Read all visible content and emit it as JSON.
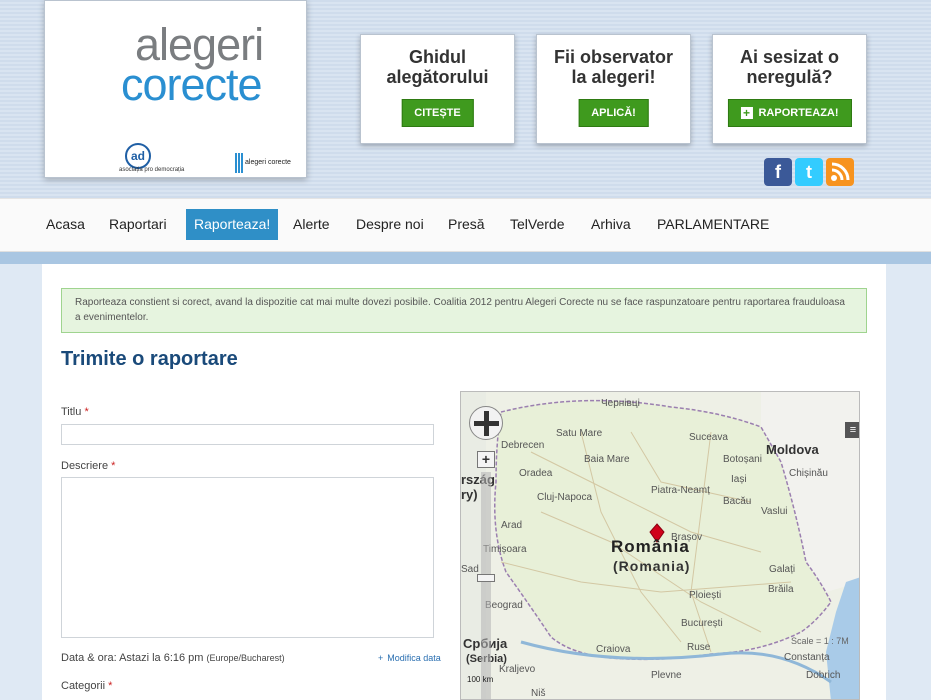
{
  "header": {
    "logo_line1": "alegeri",
    "logo_line2": "corecte",
    "partner_logo_mark": "ad",
    "partner_caption": "asociația pro democrația",
    "small_logo_text": "alegeri corecte"
  },
  "promos": [
    {
      "title_line1": "Ghidul",
      "title_line2": "alegătorului",
      "button": "CITEȘTE"
    },
    {
      "title_line1": "Fii observator",
      "title_line2": "la alegeri!",
      "button": "APLICĂ!"
    },
    {
      "title_line1": "Ai sesizat o",
      "title_line2": "neregulă?",
      "button": "RAPORTEAZA!"
    }
  ],
  "social": {
    "facebook": "f",
    "twitter": "t",
    "rss": "rss"
  },
  "nav": [
    "Acasa",
    "Raportari",
    "Raporteaza!",
    "Alerte",
    "Despre noi",
    "Presă",
    "TelVerde",
    "Arhiva",
    "PARLAMENTARE"
  ],
  "notice": "Raporteaza constient si corect, avand la dispozitie cat mai multe dovezi posibile. Coalitia 2012 pentru Alegeri Corecte nu se face raspunzatoare pentru raportarea frauduloasa a evenimentelor.",
  "form": {
    "title": "Trimite o raportare",
    "titlu_label": "Titlu",
    "titlu_value": "",
    "descriere_label": "Descriere",
    "descriere_value": "",
    "required_mark": "*",
    "date_prefix": "Data & ora: Astazi la 6:16 pm",
    "date_tz": "(Europe/Bucharest)",
    "modify_link": "Modifica data",
    "categorii_label": "Categorii"
  },
  "map": {
    "country": "România",
    "country_sub": "(Romania)",
    "neighbors": [
      "Moldova",
      "rszág",
      "ry)",
      "Србија",
      "(Serbia)"
    ],
    "cities": [
      "Чернівці",
      "Satu Mare",
      "Suceava",
      "Debrecen",
      "Baia Mare",
      "Botoșani",
      "Chișinău",
      "Oradea",
      "Iași",
      "Piatra-Neamț",
      "Cluj-Napoca",
      "Bacău",
      "Vaslui",
      "Arad",
      "Brașov",
      "Timișoara",
      "Galați",
      "Sad",
      "Ploiești",
      "Brăila",
      "Beograd",
      "București",
      "Constanța",
      "Craiova",
      "Ruse",
      "Dobrich",
      "Kraljevo",
      "Plevne",
      "Niš"
    ],
    "scale_label": "Scale = 1 : 7M",
    "scale_bar": "100 km",
    "accent_color": "#d0021b"
  },
  "colors": {
    "brand_blue": "#2a8fd1",
    "nav_active": "#2f8fc7",
    "button_green": "#3f9a1e",
    "title_blue": "#1a4a7a"
  }
}
